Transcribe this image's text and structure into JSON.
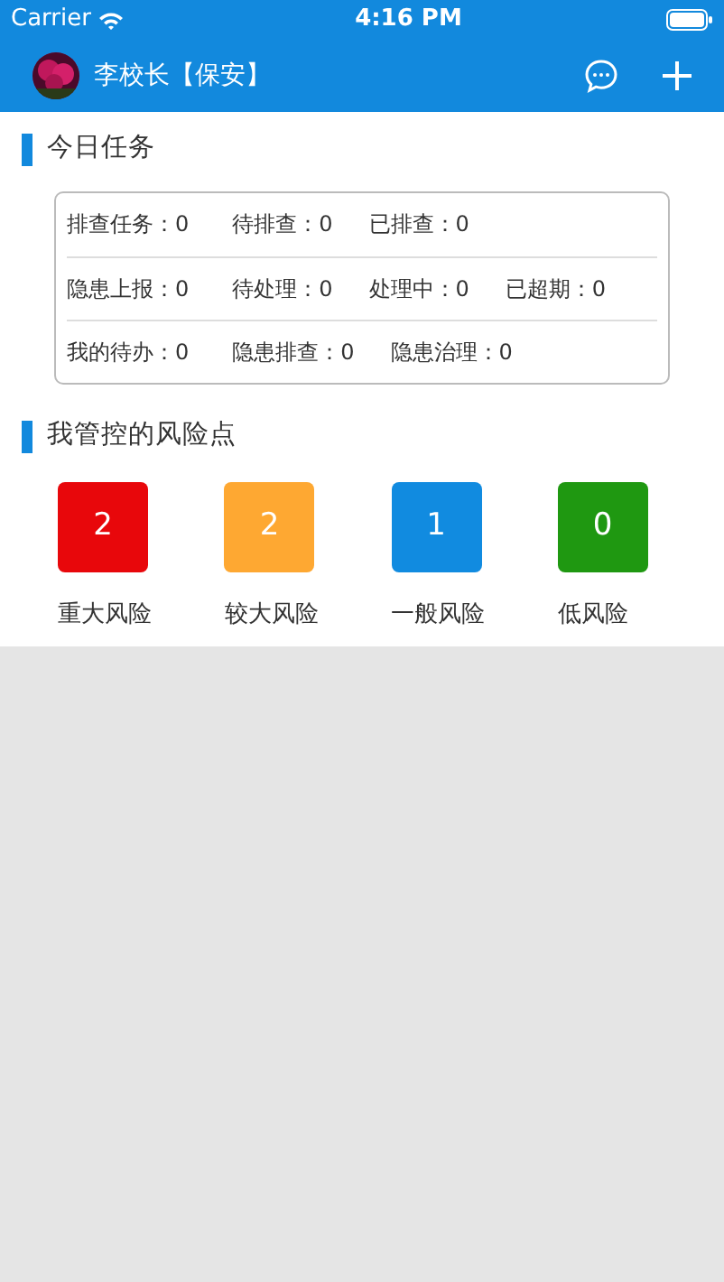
{
  "status_bar": {
    "carrier": "Carrier",
    "time": "4:16 PM"
  },
  "header": {
    "title": "李校长【保安】"
  },
  "sections": [
    {
      "title": "今日任务",
      "task_rows": [
        [
          {
            "label": "排查任务：",
            "value": "0"
          },
          {
            "label": "待排查：",
            "value": "0"
          },
          {
            "label": "已排查：",
            "value": "0"
          }
        ],
        [
          {
            "label": "隐患上报：",
            "value": "0"
          },
          {
            "label": "待处理：",
            "value": "0"
          },
          {
            "label": "处理中：",
            "value": "0"
          },
          {
            "label": "已超期：",
            "value": "0"
          }
        ],
        [
          {
            "label": "我的待办：",
            "value": "0"
          },
          {
            "label": "隐患排查：",
            "value": "0"
          },
          {
            "label": "隐患治理：",
            "value": "0"
          }
        ]
      ]
    },
    {
      "title": "我管控的风险点",
      "risks": [
        {
          "count": "2",
          "label": "重大风险",
          "color": "#e8070b"
        },
        {
          "count": "2",
          "label": "较大风险",
          "color": "#fea832"
        },
        {
          "count": "1",
          "label": "一般风险",
          "color": "#118be0"
        },
        {
          "count": "0",
          "label": "低风险",
          "color": "#1f9811"
        }
      ]
    }
  ]
}
